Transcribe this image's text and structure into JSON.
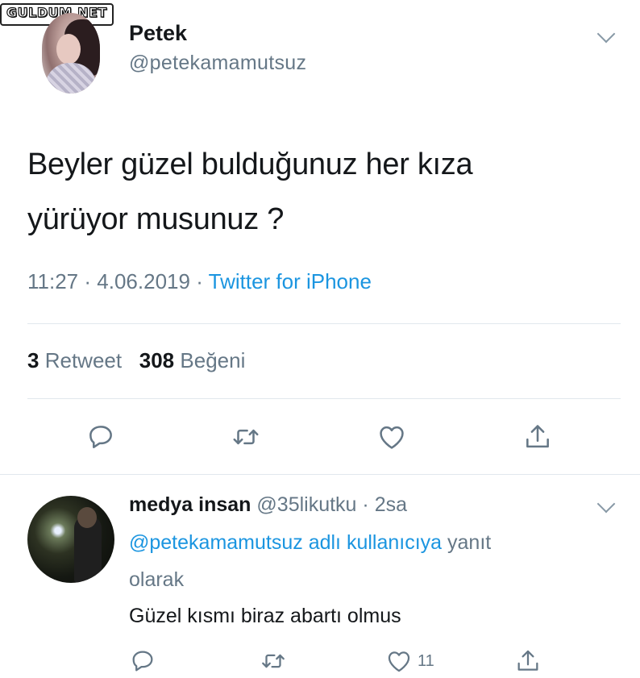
{
  "watermark": {
    "text": "GULDUM.NET"
  },
  "tweet": {
    "author_name": "Petek",
    "author_handle": "@petekamamutsuz",
    "text_line1": "Beyler güzel bulduğunuz her kıza",
    "text_line2": "yürüyor musunuz ?",
    "time": "11:27",
    "date": "4.06.2019",
    "separator": "·",
    "source": "Twitter for iPhone",
    "retweet_count": "3",
    "retweet_label": "Retweet",
    "like_count": "308",
    "like_label": "Beğeni",
    "menu_icon": "chevron-down-icon",
    "actions": [
      "reply-icon",
      "retweet-icon",
      "like-icon",
      "share-icon"
    ]
  },
  "reply": {
    "author_name": "medya insan",
    "author_handle": "@35likutku",
    "separator": "·",
    "time_ago": "2sa",
    "reply_to_handle": "@petekamamutsuz adlı kullanıcıya",
    "reply_to_suffix": "yanıt",
    "reply_to_line2": "olarak",
    "text": "Güzel kısmı biraz abartı olmus",
    "like_count": "11",
    "menu_icon": "chevron-down-icon",
    "actions": [
      "reply-icon",
      "retweet-icon",
      "like-icon",
      "share-icon"
    ]
  },
  "colors": {
    "text": "#14171a",
    "secondary": "#657786",
    "link": "#1b95e0",
    "divider": "#e1e8ed",
    "icon": "#657786"
  }
}
